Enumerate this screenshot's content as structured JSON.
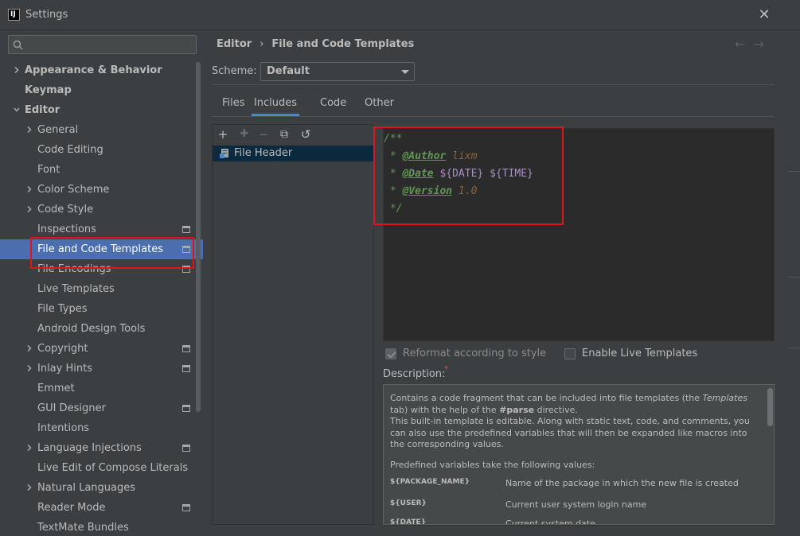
{
  "window": {
    "title": "Settings",
    "close_label": "✕"
  },
  "search": {
    "placeholder": ""
  },
  "sidebar": {
    "items": [
      {
        "label": "Appearance & Behavior",
        "level": 0,
        "chevron": "right",
        "bold": true
      },
      {
        "label": "Keymap",
        "level": 0,
        "bold": true
      },
      {
        "label": "Editor",
        "level": 0,
        "chevron": "down",
        "bold": true
      },
      {
        "label": "General",
        "level": 1,
        "chevron": "right"
      },
      {
        "label": "Code Editing",
        "level": 1
      },
      {
        "label": "Font",
        "level": 1
      },
      {
        "label": "Color Scheme",
        "level": 1,
        "chevron": "right"
      },
      {
        "label": "Code Style",
        "level": 1,
        "chevron": "right"
      },
      {
        "label": "Inspections",
        "level": 1,
        "project_icon": true
      },
      {
        "label": "File and Code Templates",
        "level": 1,
        "selected": true,
        "project_icon": true
      },
      {
        "label": "File Encodings",
        "level": 1,
        "project_icon": true
      },
      {
        "label": "Live Templates",
        "level": 1
      },
      {
        "label": "File Types",
        "level": 1
      },
      {
        "label": "Android Design Tools",
        "level": 1
      },
      {
        "label": "Copyright",
        "level": 1,
        "chevron": "right",
        "project_icon": true
      },
      {
        "label": "Inlay Hints",
        "level": 1,
        "chevron": "right",
        "project_icon": true
      },
      {
        "label": "Emmet",
        "level": 1
      },
      {
        "label": "GUI Designer",
        "level": 1,
        "project_icon": true
      },
      {
        "label": "Intentions",
        "level": 1
      },
      {
        "label": "Language Injections",
        "level": 1,
        "chevron": "right",
        "project_icon": true
      },
      {
        "label": "Live Edit of Compose Literals",
        "level": 1
      },
      {
        "label": "Natural Languages",
        "level": 1,
        "chevron": "right"
      },
      {
        "label": "Reader Mode",
        "level": 1,
        "project_icon": true
      },
      {
        "label": "TextMate Bundles",
        "level": 1
      }
    ]
  },
  "breadcrumb": {
    "part1": "Editor",
    "separator": "›",
    "part2": "File and Code Templates"
  },
  "nav": {
    "back": "←",
    "forward": "→"
  },
  "scheme": {
    "label": "Scheme:",
    "value": "Default"
  },
  "tabs": [
    {
      "label": "Files",
      "active": false
    },
    {
      "label": "Includes",
      "active": true
    },
    {
      "label": "Code",
      "active": false
    },
    {
      "label": "Other",
      "active": false
    }
  ],
  "toolbar": {
    "add": "+",
    "copy_dim": "✚",
    "remove": "−",
    "duplicate": "⧉",
    "reset": "↺"
  },
  "template_list": [
    {
      "label": "File Header",
      "selected": true
    }
  ],
  "editor": {
    "line1": "/**",
    "line2_star": " * ",
    "line2_tag": "@Author",
    "line2_val": " lixm",
    "line3_star": " * ",
    "line3_tag": "@Date",
    "line3_sp": " ",
    "line3_var1": "${DATE}",
    "line3_sp2": " ",
    "line3_var2": "${TIME}",
    "line4_star": " * ",
    "line4_tag": "@Version",
    "line4_val": " 1.0",
    "line5": " */"
  },
  "options": {
    "reformat_label": "Reformat according to style",
    "reformat_checked": true,
    "live_templates_label": "Enable Live Templates",
    "live_templates_checked": false
  },
  "description": {
    "label": "Description:",
    "star": "*",
    "p1_a": "Contains a code fragment that can be included into file templates (the ",
    "p1_i": "Templates",
    "p1_b": " tab) with the help of the ",
    "p1_bold": "#parse",
    "p1_c": " directive.",
    "p2": "This built-in template is editable. Along with static text, code, and comments, you can also use the predefined variables that will then be expanded like macros into the corresponding values.",
    "p3": "Predefined variables take the following values:",
    "variables": [
      {
        "name": "${PACKAGE_NAME}",
        "desc": "Name of the package in which the new file is created"
      },
      {
        "name": "${USER}",
        "desc": "Current user system login name"
      },
      {
        "name": "${DATE}",
        "desc": "Current system date"
      }
    ]
  }
}
